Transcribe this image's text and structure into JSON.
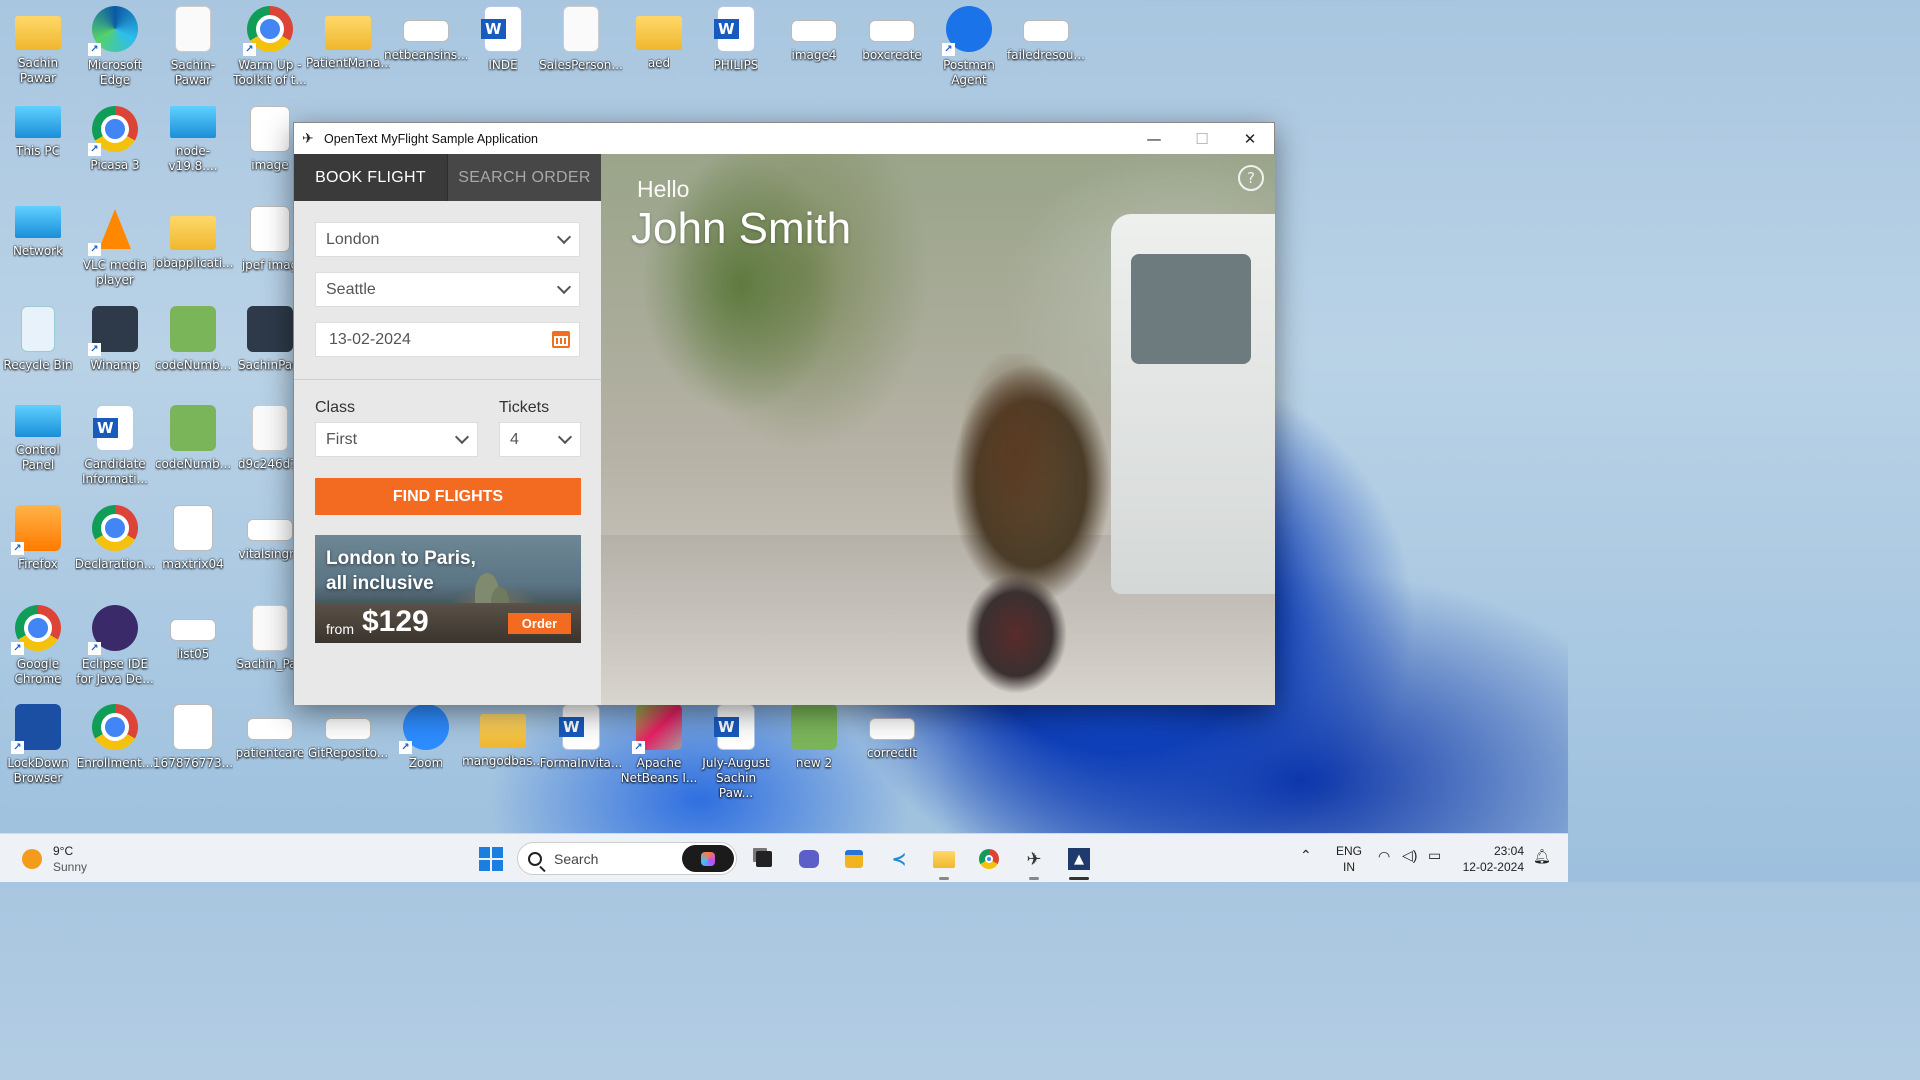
{
  "desktop": {
    "icons": [
      {
        "label": "Sachin Pawar",
        "icon": "user-folder-icon"
      },
      {
        "label": "Microsoft\nEdge",
        "icon": "edge-icon"
      },
      {
        "label": "Sachin-Pawar",
        "icon": "document-icon"
      },
      {
        "label": "Warm Up -\nToolkit of t...",
        "icon": "chrome-icon"
      },
      {
        "label": "PatientMana...",
        "icon": "folder-icon"
      },
      {
        "label": "netbeansins...",
        "icon": "image-icon"
      },
      {
        "label": "INDE",
        "icon": "word-icon"
      },
      {
        "label": "SalesPerson...",
        "icon": "document-icon"
      },
      {
        "label": "aed",
        "icon": "folder-icon"
      },
      {
        "label": "PHILIPS",
        "icon": "word-icon"
      },
      {
        "label": "image4",
        "icon": "image-icon"
      },
      {
        "label": "boxcreate",
        "icon": "image-icon"
      },
      {
        "label": "Postman\nAgent",
        "icon": "postman-icon"
      },
      {
        "label": "failedresou...",
        "icon": "image-icon"
      },
      {
        "label": "This PC",
        "icon": "this-pc-icon"
      },
      {
        "label": "Picasa 3",
        "icon": "picasa-icon"
      },
      {
        "label": "node-v19.8....",
        "icon": "installer-icon"
      },
      {
        "label": "image",
        "icon": "spreadsheet-icon"
      },
      {
        "label": "Network",
        "icon": "network-icon"
      },
      {
        "label": "VLC media\nplayer",
        "icon": "vlc-icon"
      },
      {
        "label": "jobapplicati...",
        "icon": "folder-icon"
      },
      {
        "label": "jpef imag",
        "icon": "spreadsheet-icon"
      },
      {
        "label": "Recycle Bin",
        "icon": "recycle-bin-icon"
      },
      {
        "label": "Winamp",
        "icon": "winamp-icon"
      },
      {
        "label": "codeNumb...",
        "icon": "code-file-icon"
      },
      {
        "label": "SachinPaw",
        "icon": "photo-icon"
      },
      {
        "label": "Control Panel",
        "icon": "control-panel-icon"
      },
      {
        "label": "Candidate\nInformati...",
        "icon": "word-icon"
      },
      {
        "label": "codeNumb...",
        "icon": "code-file-icon"
      },
      {
        "label": "d9c246d7-",
        "icon": "document-icon"
      },
      {
        "label": "Firefox",
        "icon": "firefox-icon"
      },
      {
        "label": "Declaration...",
        "icon": "chrome-icon"
      },
      {
        "label": "maxtrix04",
        "icon": "spreadsheet-icon"
      },
      {
        "label": "vitalsingra",
        "icon": "image-icon"
      },
      {
        "label": "Google\nChrome",
        "icon": "chrome-icon"
      },
      {
        "label": "Eclipse IDE\nfor Java De...",
        "icon": "eclipse-icon"
      },
      {
        "label": "list05",
        "icon": "image-icon"
      },
      {
        "label": "Sachin_Pav",
        "icon": "document-icon"
      },
      {
        "label": "LockDown\nBrowser",
        "icon": "lockdown-icon"
      },
      {
        "label": "Enrollment...",
        "icon": "chrome-icon"
      },
      {
        "label": "167876773...",
        "icon": "spreadsheet-icon"
      },
      {
        "label": "patientcare",
        "icon": "image-icon"
      },
      {
        "label": "GitReposito...",
        "icon": "image-icon"
      },
      {
        "label": "Zoom",
        "icon": "zoom-icon"
      },
      {
        "label": "mangodbas...",
        "icon": "folder-icon"
      },
      {
        "label": "FormaInvita...",
        "icon": "word-icon"
      },
      {
        "label": "Apache\nNetBeans I...",
        "icon": "netbeans-icon"
      },
      {
        "label": "July-August\nSachin Paw...",
        "icon": "word-icon"
      },
      {
        "label": "new 2",
        "icon": "code-file-icon"
      },
      {
        "label": "correctIt",
        "icon": "image-icon"
      }
    ]
  },
  "window": {
    "title": "OpenText MyFlight Sample Application",
    "minimize": "—",
    "maximize": "☐",
    "close": "✕"
  },
  "booking": {
    "tabs": {
      "book": "BOOK FLIGHT",
      "search": "SEARCH ORDER"
    },
    "from": "London",
    "to": "Seattle",
    "date": "13-02-2024",
    "class_label": "Class",
    "class_value": "First",
    "tickets_label": "Tickets",
    "tickets_value": "4",
    "find_button": "FIND FLIGHTS"
  },
  "promo": {
    "headline_line1": "London to Paris,",
    "headline_line2": "all inclusive",
    "from": "from",
    "price": "$129",
    "order": "Order"
  },
  "hero": {
    "greeting": "Hello",
    "user_name": "John Smith",
    "help": "?"
  },
  "taskbar": {
    "temperature": "9°C",
    "condition": "Sunny",
    "search_placeholder": "Search",
    "language_line1": "ENG",
    "language_line2": "IN",
    "time": "23:04",
    "date": "12-02-2024"
  }
}
